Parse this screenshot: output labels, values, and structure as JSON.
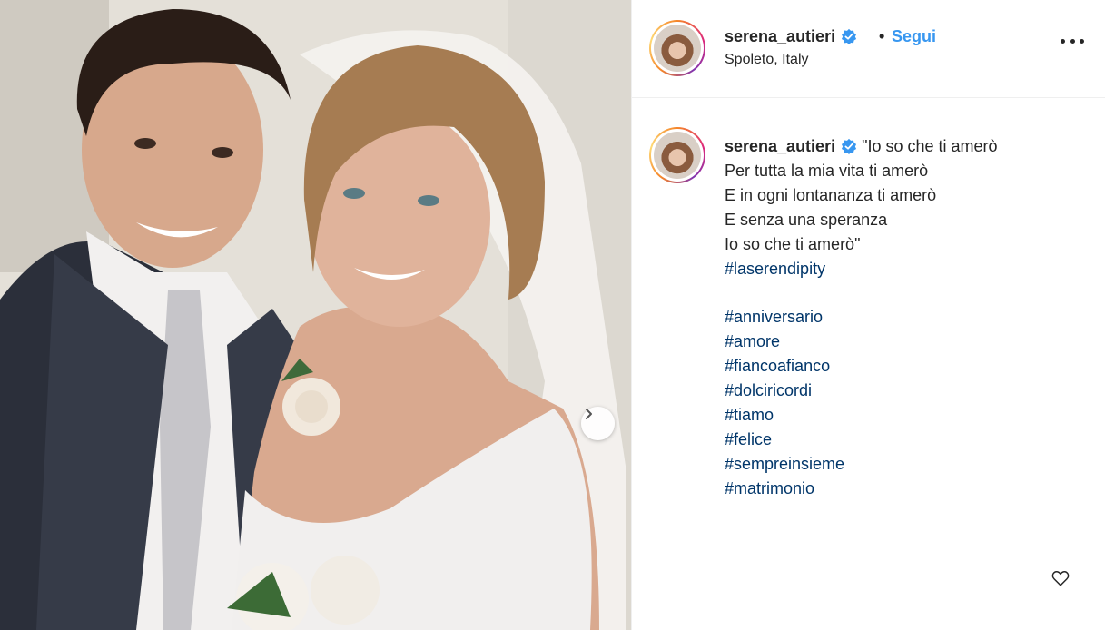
{
  "post": {
    "username": "serena_autieri",
    "separator": "•",
    "follow_label": "Segui",
    "location": "Spoleto, Italy"
  },
  "caption": {
    "username": "serena_autieri",
    "lines": [
      "\"Io so che ti amerò",
      "Per tutta la mia vita ti amerò",
      "E in ogni lontananza ti amerò",
      "E senza una speranza",
      "Io so che ti amerò\""
    ],
    "hashtag_first": "#laserendipity",
    "hashtags": [
      "#anniversario",
      "#amore",
      "#fiancoafianco",
      "#dolciricordi",
      "#tiamo",
      "#felice",
      "#sempreinsieme",
      "#matrimonio"
    ]
  },
  "icons": {
    "verified": "verified-badge-icon",
    "more": "more-options-icon",
    "next": "chevron-right-icon",
    "like": "heart-icon"
  },
  "colors": {
    "link_blue": "#3897f0",
    "hashtag": "#003569",
    "verified": "#3897f0",
    "text": "#262626"
  }
}
